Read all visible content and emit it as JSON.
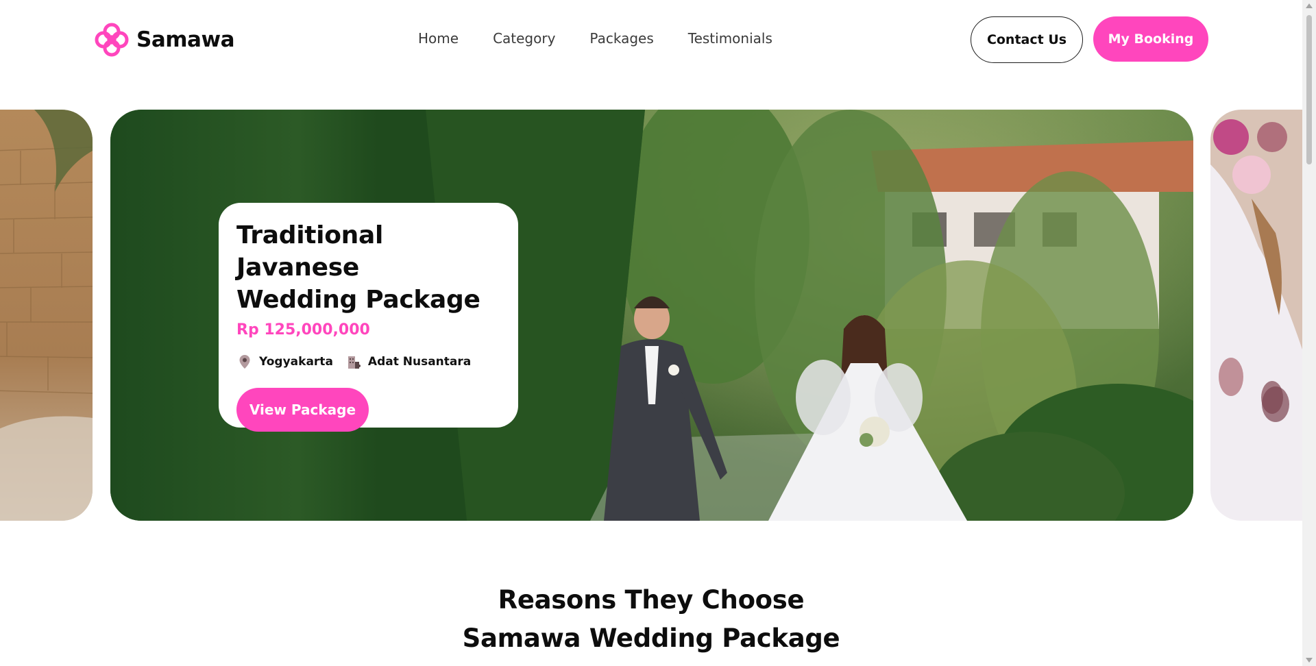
{
  "brand": {
    "name": "Samawa",
    "icon": "flower-logo-icon",
    "accent": "#ff46bd"
  },
  "nav": {
    "links": [
      "Home",
      "Category",
      "Packages",
      "Testimonials"
    ],
    "contact_label": "Contact Us",
    "booking_label": "My Booking"
  },
  "hero": {
    "slides": [
      {
        "name": "stone-wall-slide",
        "image": "stone-wall-photo"
      },
      {
        "name": "garden-couple-slide",
        "image": "wedding-couple-photo"
      },
      {
        "name": "floral-decor-slide",
        "image": "floral-decor-photo"
      }
    ],
    "card": {
      "title_line1": "Traditional Javanese",
      "title_line2": "Wedding Package",
      "price": "Rp 125,000,000",
      "location": "Yogyakarta",
      "location_icon": "location-pin-icon",
      "category": "Adat Nusantara",
      "category_icon": "building-icon",
      "button_label": "View Package"
    }
  },
  "reasons": {
    "title_line1": "Reasons They Choose",
    "title_line2": "Samawa Wedding Package"
  }
}
